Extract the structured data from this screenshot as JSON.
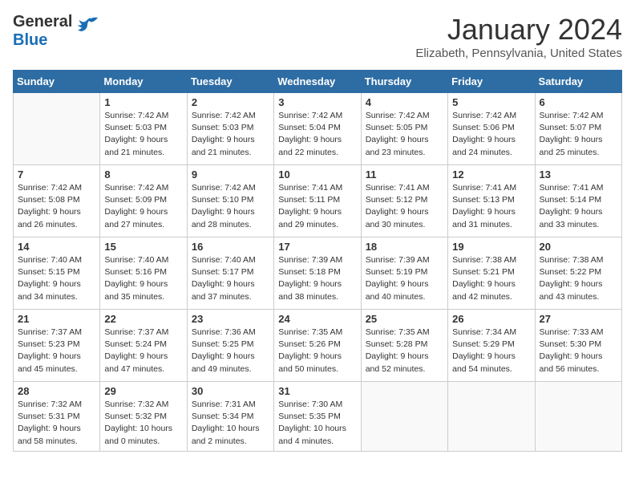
{
  "header": {
    "logo_general": "General",
    "logo_blue": "Blue",
    "month_title": "January 2024",
    "location": "Elizabeth, Pennsylvania, United States"
  },
  "days_of_week": [
    "Sunday",
    "Monday",
    "Tuesday",
    "Wednesday",
    "Thursday",
    "Friday",
    "Saturday"
  ],
  "weeks": [
    [
      {
        "day": "",
        "sunrise": "",
        "sunset": "",
        "daylight": ""
      },
      {
        "day": "1",
        "sunrise": "Sunrise: 7:42 AM",
        "sunset": "Sunset: 5:03 PM",
        "daylight": "Daylight: 9 hours and 21 minutes."
      },
      {
        "day": "2",
        "sunrise": "Sunrise: 7:42 AM",
        "sunset": "Sunset: 5:03 PM",
        "daylight": "Daylight: 9 hours and 21 minutes."
      },
      {
        "day": "3",
        "sunrise": "Sunrise: 7:42 AM",
        "sunset": "Sunset: 5:04 PM",
        "daylight": "Daylight: 9 hours and 22 minutes."
      },
      {
        "day": "4",
        "sunrise": "Sunrise: 7:42 AM",
        "sunset": "Sunset: 5:05 PM",
        "daylight": "Daylight: 9 hours and 23 minutes."
      },
      {
        "day": "5",
        "sunrise": "Sunrise: 7:42 AM",
        "sunset": "Sunset: 5:06 PM",
        "daylight": "Daylight: 9 hours and 24 minutes."
      },
      {
        "day": "6",
        "sunrise": "Sunrise: 7:42 AM",
        "sunset": "Sunset: 5:07 PM",
        "daylight": "Daylight: 9 hours and 25 minutes."
      }
    ],
    [
      {
        "day": "7",
        "sunrise": "Sunrise: 7:42 AM",
        "sunset": "Sunset: 5:08 PM",
        "daylight": "Daylight: 9 hours and 26 minutes."
      },
      {
        "day": "8",
        "sunrise": "Sunrise: 7:42 AM",
        "sunset": "Sunset: 5:09 PM",
        "daylight": "Daylight: 9 hours and 27 minutes."
      },
      {
        "day": "9",
        "sunrise": "Sunrise: 7:42 AM",
        "sunset": "Sunset: 5:10 PM",
        "daylight": "Daylight: 9 hours and 28 minutes."
      },
      {
        "day": "10",
        "sunrise": "Sunrise: 7:41 AM",
        "sunset": "Sunset: 5:11 PM",
        "daylight": "Daylight: 9 hours and 29 minutes."
      },
      {
        "day": "11",
        "sunrise": "Sunrise: 7:41 AM",
        "sunset": "Sunset: 5:12 PM",
        "daylight": "Daylight: 9 hours and 30 minutes."
      },
      {
        "day": "12",
        "sunrise": "Sunrise: 7:41 AM",
        "sunset": "Sunset: 5:13 PM",
        "daylight": "Daylight: 9 hours and 31 minutes."
      },
      {
        "day": "13",
        "sunrise": "Sunrise: 7:41 AM",
        "sunset": "Sunset: 5:14 PM",
        "daylight": "Daylight: 9 hours and 33 minutes."
      }
    ],
    [
      {
        "day": "14",
        "sunrise": "Sunrise: 7:40 AM",
        "sunset": "Sunset: 5:15 PM",
        "daylight": "Daylight: 9 hours and 34 minutes."
      },
      {
        "day": "15",
        "sunrise": "Sunrise: 7:40 AM",
        "sunset": "Sunset: 5:16 PM",
        "daylight": "Daylight: 9 hours and 35 minutes."
      },
      {
        "day": "16",
        "sunrise": "Sunrise: 7:40 AM",
        "sunset": "Sunset: 5:17 PM",
        "daylight": "Daylight: 9 hours and 37 minutes."
      },
      {
        "day": "17",
        "sunrise": "Sunrise: 7:39 AM",
        "sunset": "Sunset: 5:18 PM",
        "daylight": "Daylight: 9 hours and 38 minutes."
      },
      {
        "day": "18",
        "sunrise": "Sunrise: 7:39 AM",
        "sunset": "Sunset: 5:19 PM",
        "daylight": "Daylight: 9 hours and 40 minutes."
      },
      {
        "day": "19",
        "sunrise": "Sunrise: 7:38 AM",
        "sunset": "Sunset: 5:21 PM",
        "daylight": "Daylight: 9 hours and 42 minutes."
      },
      {
        "day": "20",
        "sunrise": "Sunrise: 7:38 AM",
        "sunset": "Sunset: 5:22 PM",
        "daylight": "Daylight: 9 hours and 43 minutes."
      }
    ],
    [
      {
        "day": "21",
        "sunrise": "Sunrise: 7:37 AM",
        "sunset": "Sunset: 5:23 PM",
        "daylight": "Daylight: 9 hours and 45 minutes."
      },
      {
        "day": "22",
        "sunrise": "Sunrise: 7:37 AM",
        "sunset": "Sunset: 5:24 PM",
        "daylight": "Daylight: 9 hours and 47 minutes."
      },
      {
        "day": "23",
        "sunrise": "Sunrise: 7:36 AM",
        "sunset": "Sunset: 5:25 PM",
        "daylight": "Daylight: 9 hours and 49 minutes."
      },
      {
        "day": "24",
        "sunrise": "Sunrise: 7:35 AM",
        "sunset": "Sunset: 5:26 PM",
        "daylight": "Daylight: 9 hours and 50 minutes."
      },
      {
        "day": "25",
        "sunrise": "Sunrise: 7:35 AM",
        "sunset": "Sunset: 5:28 PM",
        "daylight": "Daylight: 9 hours and 52 minutes."
      },
      {
        "day": "26",
        "sunrise": "Sunrise: 7:34 AM",
        "sunset": "Sunset: 5:29 PM",
        "daylight": "Daylight: 9 hours and 54 minutes."
      },
      {
        "day": "27",
        "sunrise": "Sunrise: 7:33 AM",
        "sunset": "Sunset: 5:30 PM",
        "daylight": "Daylight: 9 hours and 56 minutes."
      }
    ],
    [
      {
        "day": "28",
        "sunrise": "Sunrise: 7:32 AM",
        "sunset": "Sunset: 5:31 PM",
        "daylight": "Daylight: 9 hours and 58 minutes."
      },
      {
        "day": "29",
        "sunrise": "Sunrise: 7:32 AM",
        "sunset": "Sunset: 5:32 PM",
        "daylight": "Daylight: 10 hours and 0 minutes."
      },
      {
        "day": "30",
        "sunrise": "Sunrise: 7:31 AM",
        "sunset": "Sunset: 5:34 PM",
        "daylight": "Daylight: 10 hours and 2 minutes."
      },
      {
        "day": "31",
        "sunrise": "Sunrise: 7:30 AM",
        "sunset": "Sunset: 5:35 PM",
        "daylight": "Daylight: 10 hours and 4 minutes."
      },
      {
        "day": "",
        "sunrise": "",
        "sunset": "",
        "daylight": ""
      },
      {
        "day": "",
        "sunrise": "",
        "sunset": "",
        "daylight": ""
      },
      {
        "day": "",
        "sunrise": "",
        "sunset": "",
        "daylight": ""
      }
    ]
  ]
}
